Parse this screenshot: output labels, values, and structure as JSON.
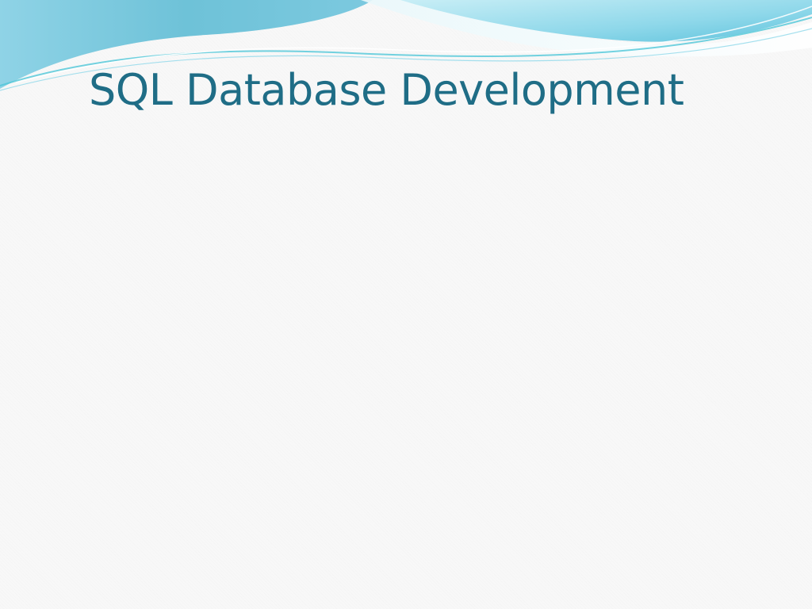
{
  "slide": {
    "title": "SQL Database Development"
  },
  "colors": {
    "title_text": "#1f6d86",
    "background": "#f8f8f8",
    "wave_dark": "#6fbfd6",
    "wave_light": "#9fdcea",
    "wave_accent": "#4fc7d8"
  }
}
